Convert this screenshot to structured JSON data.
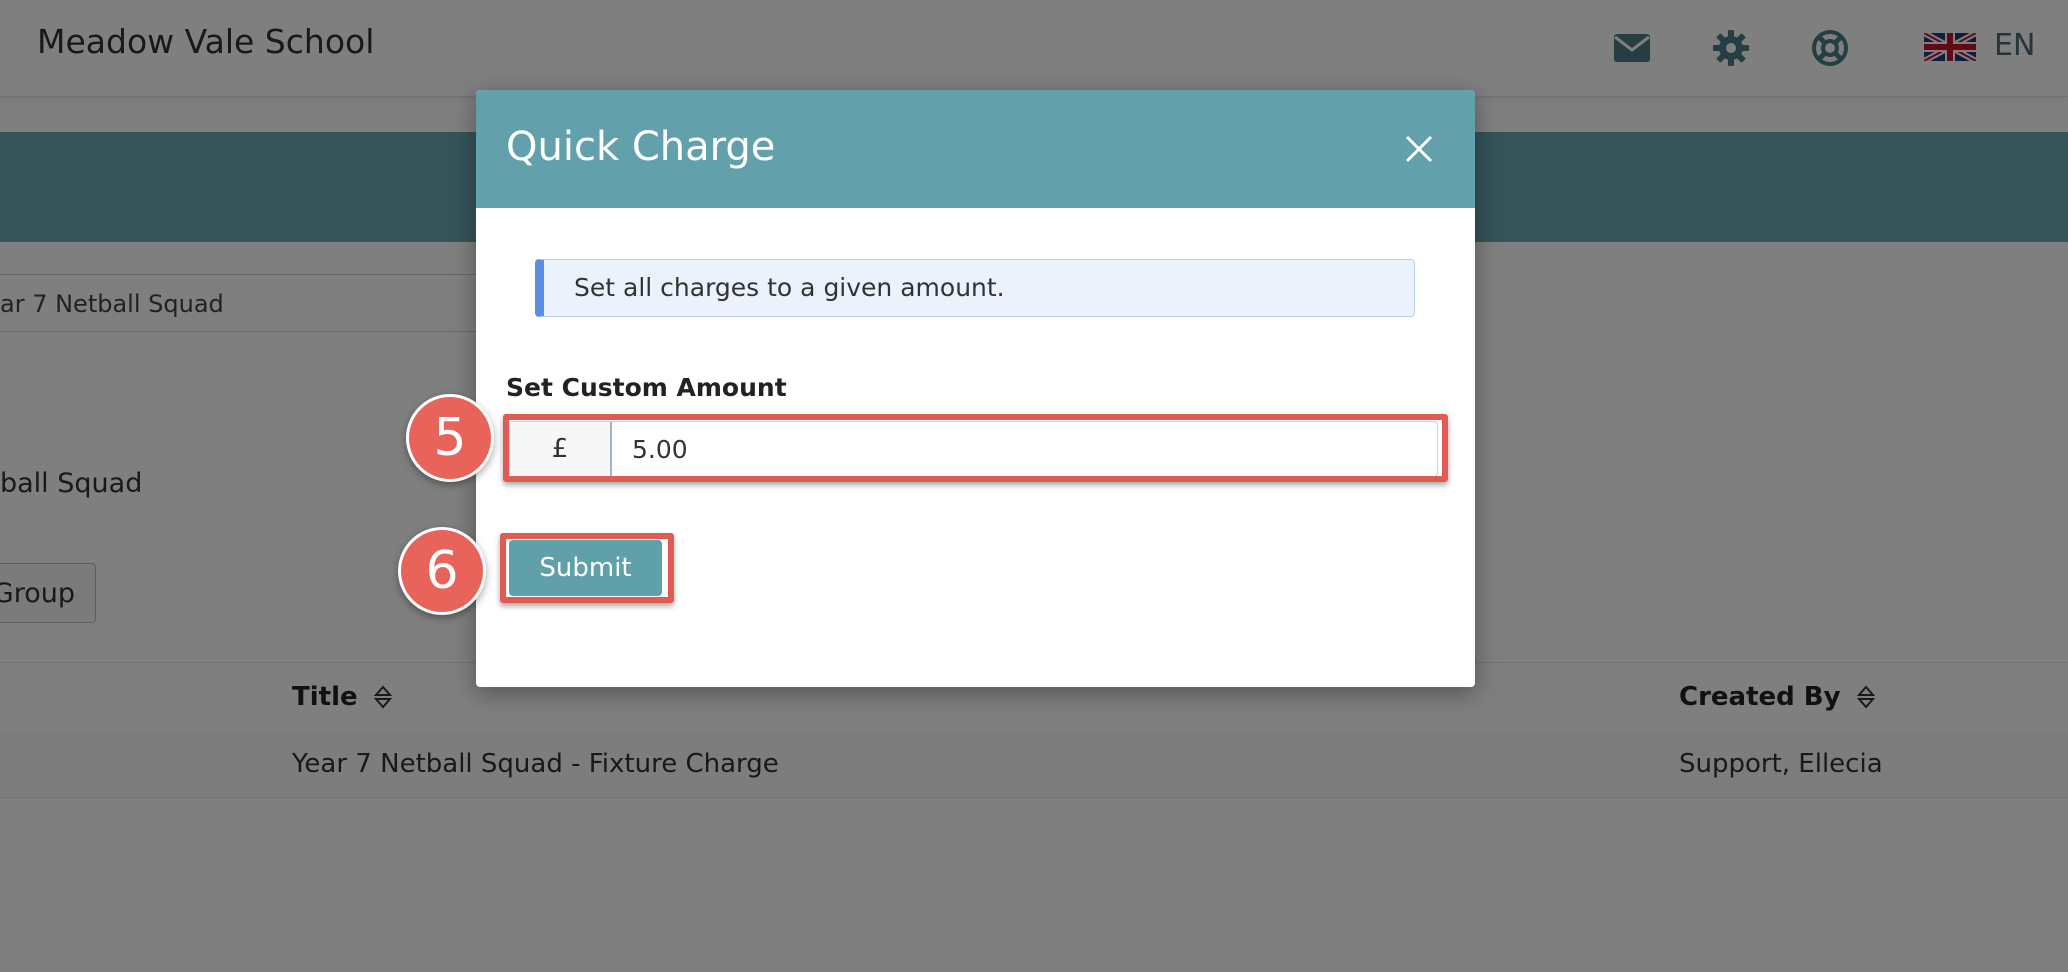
{
  "header": {
    "school_name": "Meadow Vale School",
    "language_code": "EN",
    "icons": [
      "envelope-icon",
      "gear-icon",
      "lifebuoy-icon",
      "uk-flag-icon"
    ]
  },
  "background": {
    "group_select_value": "ar 7 Netball Squad",
    "group_label": "ball Squad",
    "group_button_label": "Group",
    "table": {
      "columns": [
        "Title",
        "Created By"
      ],
      "rows": [
        {
          "title": "Year 7 Netball Squad - Fixture Charge",
          "created_by": "Support, Ellecia"
        }
      ]
    }
  },
  "modal": {
    "title": "Quick Charge",
    "info_text": "Set all charges to a given amount.",
    "field_label": "Set Custom Amount",
    "currency_symbol": "£",
    "amount_value": "5.00",
    "submit_label": "Submit"
  },
  "annotations": {
    "step_input": "5",
    "step_submit": "6"
  },
  "colors": {
    "brand_teal": "#62a1ac",
    "info_blue": "#5a8ee0",
    "annotation_red": "#e05c52"
  }
}
